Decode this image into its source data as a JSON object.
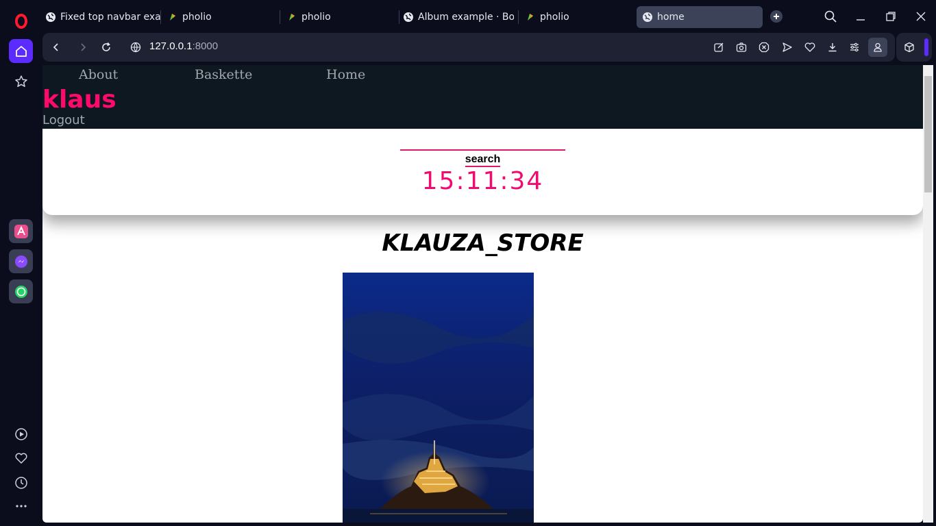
{
  "browser": {
    "tabs": [
      {
        "title": "Fixed top navbar exam",
        "icon": "globe-icon"
      },
      {
        "title": "pholio",
        "icon": "pholio-icon"
      },
      {
        "title": "pholio",
        "icon": "pholio-icon"
      },
      {
        "title": "Album example · Boot",
        "icon": "globe-icon"
      },
      {
        "title": "pholio",
        "icon": "pholio-icon"
      },
      {
        "title": "home",
        "icon": "globe-icon",
        "active": true
      }
    ],
    "url_host": "127.0.0.1",
    "url_port": ":8000",
    "accent_color": "#5b2bff"
  },
  "page": {
    "nav": {
      "links": [
        "About",
        "Baskette",
        "Home"
      ],
      "brand": "klaus",
      "logout": "Logout"
    },
    "search": {
      "label": "search",
      "clock": "15:11:34"
    },
    "store_title": "KLAUZA_STORE",
    "colors": {
      "navbar_bg": "#0e1821",
      "brand_pink": "#ff0a6c",
      "clock_pink": "#ef0b6f"
    }
  }
}
